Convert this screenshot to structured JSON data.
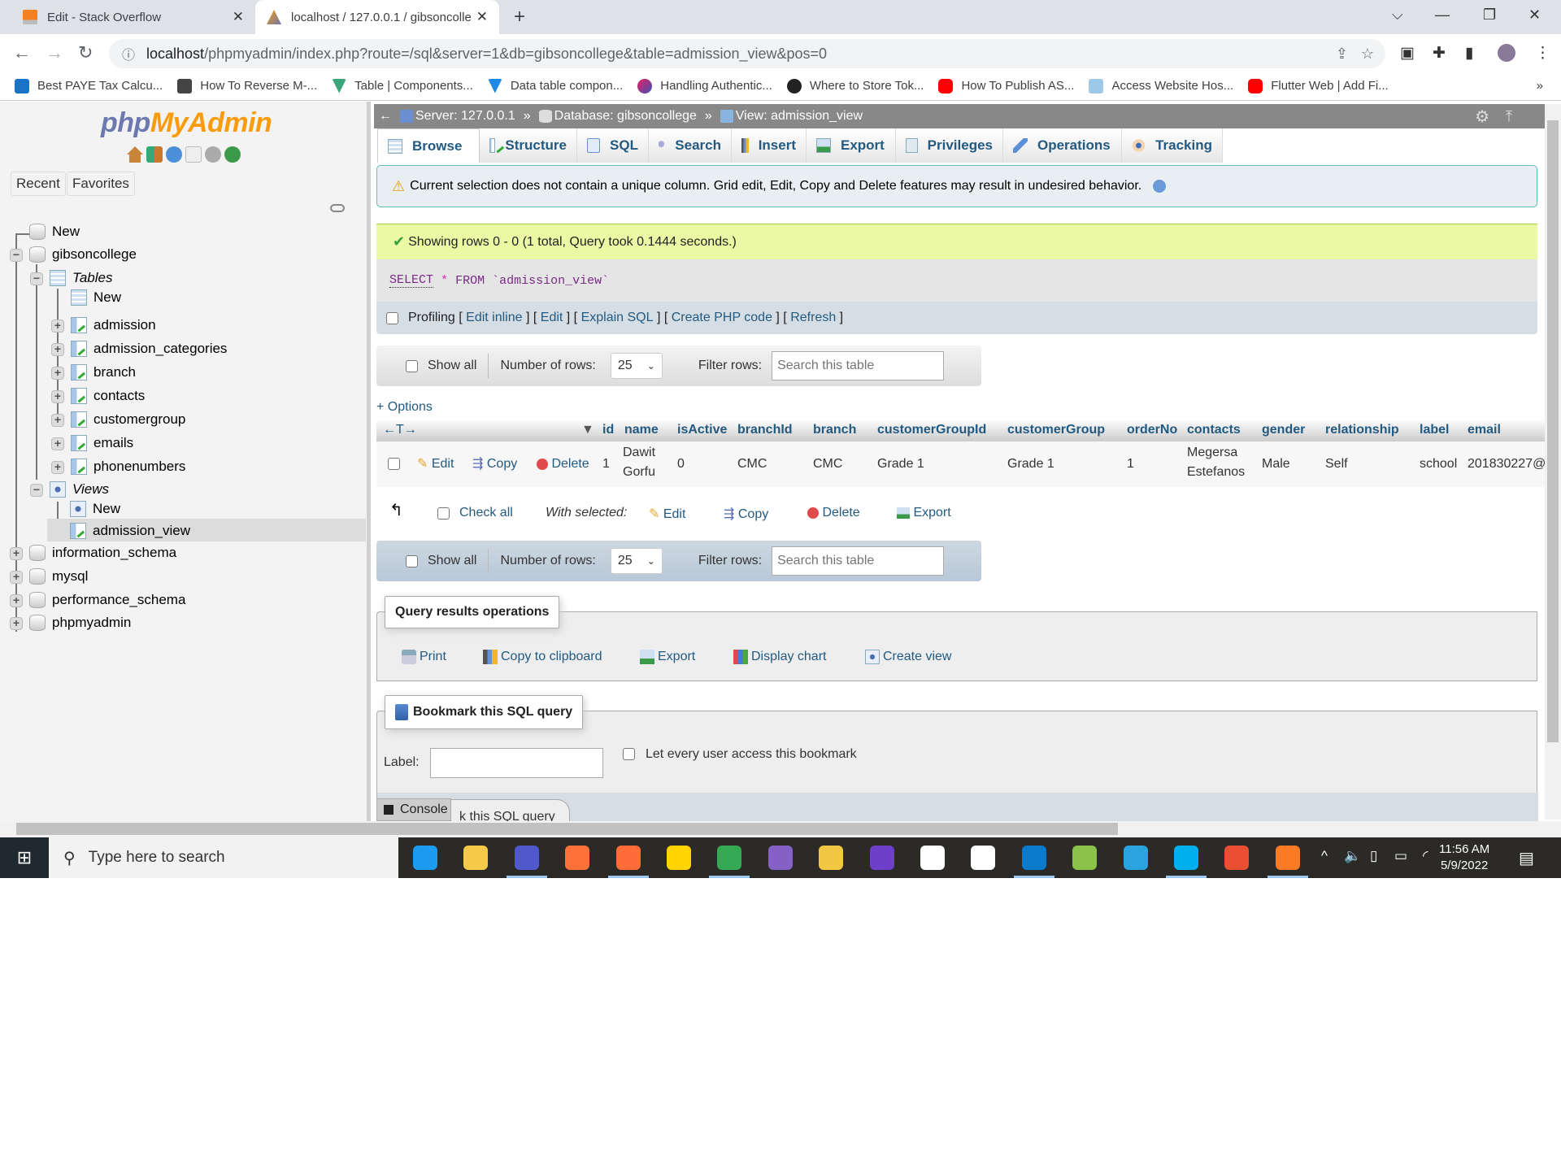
{
  "browser": {
    "tabs": [
      {
        "title": "Edit - Stack Overflow",
        "active": false,
        "icon": "stackoverflow-icon"
      },
      {
        "title": "localhost / 127.0.0.1 / gibsoncolle",
        "active": true,
        "icon": "phpmyadmin-icon"
      }
    ],
    "new_tab": "+",
    "address": {
      "host": "localhost",
      "path": "/phpmyadmin/index.php?route=/sql&server=1&db=gibsoncollege&table=admission_view&pos=0"
    },
    "bookmarks": [
      {
        "label": "Best PAYE Tax Calcu...",
        "color": "#1a73c8"
      },
      {
        "label": "How To Reverse M-...",
        "color": "#444444"
      },
      {
        "label": "Table | Components...",
        "color": "#3aa57a"
      },
      {
        "label": "Data table compon...",
        "color": "#1e88e5"
      },
      {
        "label": "Handling Authentic...",
        "color": "#7b2ff7"
      },
      {
        "label": "Where to Store Tok...",
        "color": "#222222"
      },
      {
        "label": "How To Publish AS...",
        "color": "#ff0000"
      },
      {
        "label": "Access Website Hos...",
        "color": "#9cc9e8"
      },
      {
        "label": "Flutter Web | Add Fi...",
        "color": "#ff0000"
      }
    ],
    "bookmarks_overflow": "»"
  },
  "sidebar": {
    "logo_php": "php",
    "logo_myadmin": "MyAdmin",
    "tabs": [
      "Recent",
      "Favorites"
    ],
    "tree": {
      "new_db": "New",
      "databases": [
        {
          "name": "gibsoncollege",
          "expanded": true
        },
        {
          "name": "information_schema",
          "expanded": false
        },
        {
          "name": "mysql",
          "expanded": false
        },
        {
          "name": "performance_schema",
          "expanded": false
        },
        {
          "name": "phpmyadmin",
          "expanded": false
        }
      ],
      "tables_label": "Tables",
      "tables_new": "New",
      "tables": [
        "admission",
        "admission_categories",
        "branch",
        "contacts",
        "customergroup",
        "emails",
        "phonenumbers"
      ],
      "views_label": "Views",
      "views_new": "New",
      "views": [
        "admission_view"
      ],
      "selected": "admission_view"
    }
  },
  "breadcrumb": {
    "server": "Server: 127.0.0.1",
    "database": "Database: gibsoncollege",
    "view": "View: admission_view",
    "sep": "»"
  },
  "main_tabs": [
    "Browse",
    "Structure",
    "SQL",
    "Search",
    "Insert",
    "Export",
    "Privileges",
    "Operations",
    "Tracking"
  ],
  "active_tab": "Browse",
  "warning": "Current selection does not contain a unique column. Grid edit, Edit, Copy and Delete features may result in undesired behavior.",
  "success": "Showing rows 0 - 0 (1 total, Query took 0.1444 seconds.)",
  "sql": {
    "select": "SELECT",
    "star": "*",
    "from": "FROM",
    "table": "`admission_view`"
  },
  "profiling": {
    "label": "Profiling",
    "links": [
      "Edit inline",
      "Edit",
      "Explain SQL",
      "Create PHP code",
      "Refresh"
    ]
  },
  "nav": {
    "show_all": "Show all",
    "rows_label": "Number of rows:",
    "rows_value": "25",
    "filter_label": "Filter rows:",
    "filter_placeholder": "Search this table"
  },
  "options_link": "+ Options",
  "table": {
    "columns": [
      "id",
      "name",
      "isActive",
      "branchId",
      "branch",
      "customerGroupId",
      "customerGroup",
      "orderNo",
      "contacts",
      "gender",
      "relationship",
      "label",
      "email"
    ],
    "row_actions": [
      "Edit",
      "Copy",
      "Delete"
    ],
    "rows": [
      {
        "id": "1",
        "name": [
          "Dawit",
          "Gorfu"
        ],
        "isActive": "0",
        "branchId": "CMC",
        "branch": "CMC",
        "customerGroupId": "Grade 1",
        "customerGroup": "Grade 1",
        "orderNo": "1",
        "contacts": [
          "Megersa",
          "Estefanos"
        ],
        "gender": "Male",
        "relationship": "Self",
        "label": "school",
        "email": "201830227@"
      }
    ]
  },
  "bulk": {
    "check_all": "Check all",
    "with_selected": "With selected:",
    "actions": [
      "Edit",
      "Copy",
      "Delete",
      "Export"
    ]
  },
  "query_ops": {
    "legend": "Query results operations",
    "items": [
      "Print",
      "Copy to clipboard",
      "Export",
      "Display chart",
      "Create view"
    ]
  },
  "bookmark": {
    "legend": "Bookmark this SQL query",
    "label": "Label:",
    "label_value": "",
    "share": "Let every user access this bookmark",
    "submit_partial": "k this SQL query"
  },
  "console": "Console",
  "taskbar": {
    "search_placeholder": "Type here to search",
    "apps": [
      {
        "name": "docker",
        "color": "#1d9bf0"
      },
      {
        "name": "file-explorer",
        "color": "#f7c948"
      },
      {
        "name": "teams",
        "color": "#5059c9"
      },
      {
        "name": "firefox",
        "color": "#ff7139"
      },
      {
        "name": "postman",
        "color": "#ff6c37"
      },
      {
        "name": "sticky-notes",
        "color": "#ffd400"
      },
      {
        "name": "chrome",
        "color": "#34a853"
      },
      {
        "name": "visual-studio",
        "color": "#8661c5"
      },
      {
        "name": "db-tool",
        "color": "#f2c744"
      },
      {
        "name": "github-desktop",
        "color": "#6e40c9"
      },
      {
        "name": "android-studio",
        "color": "#ffffff"
      },
      {
        "name": "slack",
        "color": "#ffffff"
      },
      {
        "name": "vscode",
        "color": "#0a7acc"
      },
      {
        "name": "notepad-plus",
        "color": "#8bc34a"
      },
      {
        "name": "telegram",
        "color": "#2aa3df"
      },
      {
        "name": "skype",
        "color": "#00aff0"
      },
      {
        "name": "git",
        "color": "#e94e31"
      },
      {
        "name": "xampp",
        "color": "#fb7a24"
      }
    ],
    "time": "11:56 AM",
    "date": "5/9/2022"
  }
}
